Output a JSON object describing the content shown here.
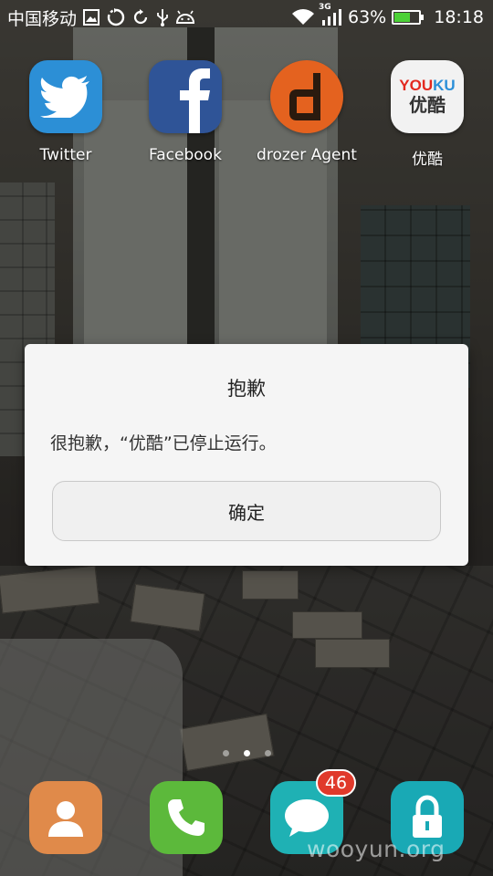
{
  "status_bar": {
    "carrier": "中国移动",
    "network_type": "3G",
    "battery_percent": "63%",
    "battery_level": 0.63,
    "time": "18:18"
  },
  "apps": [
    {
      "label": "Twitter",
      "icon": "twitter-bird-icon",
      "color": "#2c8fd6"
    },
    {
      "label": "Facebook",
      "icon": "facebook-f-icon",
      "color": "#2f5497"
    },
    {
      "label": "drozer Agent",
      "icon": "drozer-d-icon",
      "color": "#e4621f"
    },
    {
      "label": "优酷",
      "icon": "youku-icon",
      "logo_text": "YOUKU",
      "logo_cn": "优酷",
      "color": "#f2f2f2"
    }
  ],
  "dialog": {
    "title": "抱歉",
    "message": "很抱歉，“优酷”已停止运行。",
    "button_label": "确定"
  },
  "pager": {
    "pages": 3,
    "active_index": 1
  },
  "dock": [
    {
      "icon": "contacts-icon",
      "color": "#e08a4a"
    },
    {
      "icon": "phone-icon",
      "color": "#5cb93b"
    },
    {
      "icon": "messages-icon",
      "color": "#1fb1b4",
      "badge": "46"
    },
    {
      "icon": "lock-icon",
      "color": "#19a9b5"
    }
  ],
  "watermark": "wooyun.org"
}
